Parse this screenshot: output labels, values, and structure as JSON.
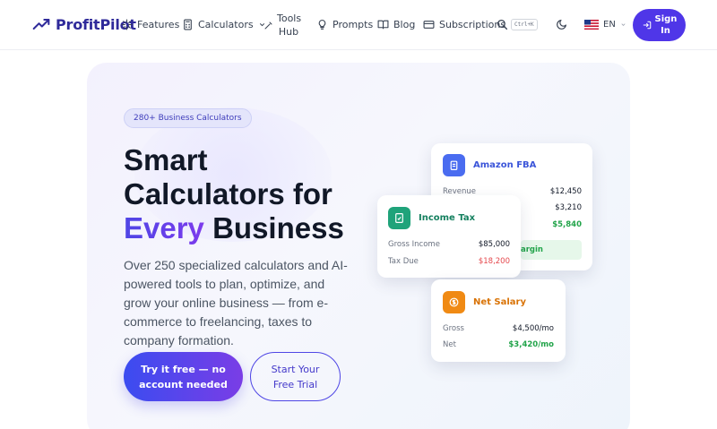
{
  "brand": {
    "name": "ProfitPilot"
  },
  "nav": {
    "features": "Features",
    "calculators": "Calculators",
    "tools_hub": "Tools Hub",
    "prompts": "Prompts",
    "blog": "Blog",
    "subscriptions": "Subscriptions",
    "search_shortcut": "Ctrl+K",
    "language": "EN",
    "sign_in": "Sign In"
  },
  "hero": {
    "badge": "280+ Business Calculators",
    "headline_line1": "Smart",
    "headline_line2": "Calculators for",
    "headline_accent": "Every",
    "headline_line3_rest": " Business",
    "subtext": "Over 250 specialized calculators and AI-powered tools to plan, optimize, and grow your online business — from e-commerce to freelancing, taxes to company formation.",
    "cta_primary": "Try it free — no account needed",
    "cta_secondary": "Start Your Free Trial"
  },
  "cards": {
    "amazon": {
      "title": "Amazon FBA",
      "rows": [
        {
          "label": "Revenue",
          "value": "$12,450"
        },
        {
          "label": "",
          "value": "$3,210"
        },
        {
          "label": "",
          "value": "$5,840"
        }
      ],
      "footer_partial": "argin"
    },
    "income_tax": {
      "title": "Income Tax",
      "rows": [
        {
          "label": "Gross Income",
          "value": "$85,000"
        },
        {
          "label": "Tax Due",
          "value": "$18,200"
        }
      ]
    },
    "salary": {
      "title": "Net Salary",
      "rows": [
        {
          "label": "Gross",
          "value": "$4,500/mo"
        },
        {
          "label": "Net",
          "value": "$3,420/mo"
        }
      ]
    }
  },
  "colors": {
    "brand": "#2f2a9a",
    "primary": "#4f36e8",
    "amazon_icon": "#4a6cf0",
    "tax_icon": "#1fa37a",
    "salary_icon": "#f08a14",
    "positive": "#22a44a",
    "negative": "#e5484d"
  }
}
